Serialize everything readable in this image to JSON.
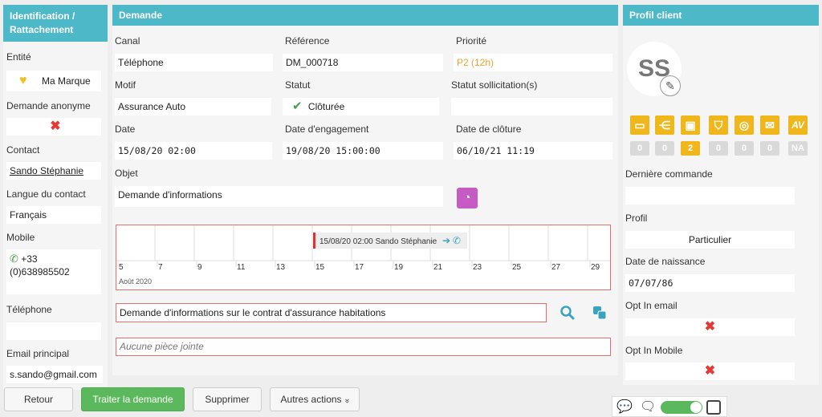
{
  "left": {
    "title": "Identification / Rattachement",
    "entite_label": "Entité",
    "entite_value": "Ma Marque",
    "anonyme_label": "Demande anonyme",
    "contact_label": "Contact",
    "contact_value": "Sando Stéphanie",
    "langue_label": "Langue du contact",
    "langue_value": "Français",
    "mobile_label": "Mobile",
    "mobile_value_line1": "+33",
    "mobile_value_line2": "(0)638985502",
    "telephone_label": "Téléphone",
    "telephone_value": "",
    "email_label": "Email principal",
    "email_value": "s.sando@gmail.com"
  },
  "demande": {
    "title": "Demande",
    "canal_label": "Canal",
    "canal_value": "Téléphone",
    "reference_label": "Référence",
    "reference_value": "DM_000718",
    "priorite_label": "Priorité",
    "priorite_value": "P2 (12h)",
    "priorite_color": "#f0a030",
    "motif_label": "Motif",
    "motif_value": "Assurance Auto",
    "statut_label": "Statut",
    "statut_value": "Clôturée",
    "statut_sollicitation_label": "Statut sollicitation(s)",
    "statut_sollicitation_value": "",
    "date_label": "Date",
    "date_value": "15/08/20 02:00",
    "date_engagement_label": "Date d'engagement",
    "date_engagement_value": "19/08/20 15:00:00",
    "date_cloture_label": "Date de clôture",
    "date_cloture_value": "06/10/21 11:19",
    "objet_label": "Objet",
    "objet_value": "Demande d'informations",
    "timeline": {
      "event_label": "15/08/20 02:00 Sando Stéphanie",
      "ticks": [
        "5",
        "7",
        "9",
        "11",
        "13",
        "15",
        "17",
        "19",
        "21",
        "23",
        "25",
        "27",
        "29"
      ],
      "month_label": "Août 2020"
    },
    "message_value": "Demande d'informations sur le contrat d'assurance habitations",
    "attachment_placeholder": "Aucune pièce jointe"
  },
  "profil": {
    "title": "Profil client",
    "avatar_initials": "SS",
    "counts": [
      "0",
      "0",
      "2",
      "0",
      "0",
      "0",
      "NA"
    ],
    "derniere_commande_label": "Dernière commande",
    "derniere_commande_value": "",
    "profil_label": "Profil",
    "profil_value": "Particulier",
    "naissance_label": "Date de naissance",
    "naissance_value": "07/07/86",
    "optin_email_label": "Opt In email",
    "optin_mobile_label": "Opt In Mobile"
  },
  "actions": {
    "retour": "Retour",
    "traiter": "Traiter la demande",
    "supprimer": "Supprimer",
    "autres": "Autres actions",
    "autres_chevron": "»"
  }
}
